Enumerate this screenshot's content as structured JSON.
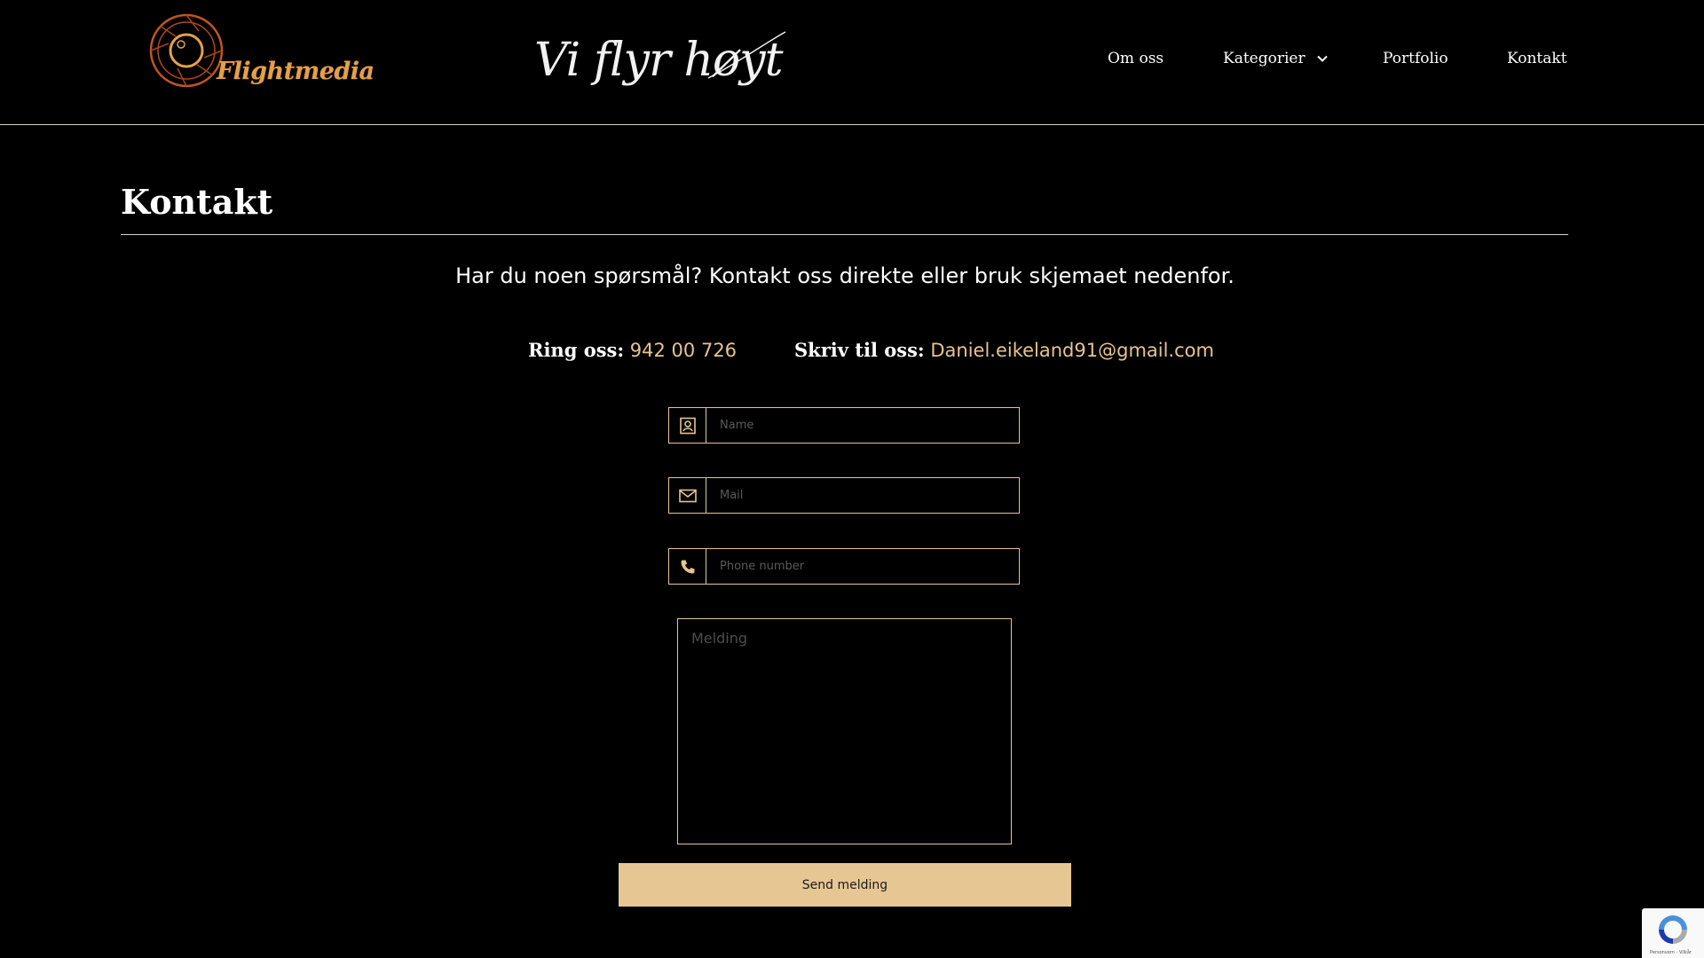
{
  "header": {
    "logo_text": "Flightmedia",
    "tagline": "Vi flyr høyt",
    "nav": [
      {
        "label": "Om oss"
      },
      {
        "label": "Kategorier"
      },
      {
        "label": "Portfolio"
      },
      {
        "label": "Kontakt"
      }
    ]
  },
  "main": {
    "title": "Kontakt",
    "intro": "Har du noen spørsmål? Kontakt oss direkte eller bruk skjemaet nedenfor.",
    "phone": {
      "label": "Ring oss:",
      "value": "942 00 726"
    },
    "email": {
      "label": "Skriv til oss:",
      "value": "Daniel.eikeland91@gmail.com"
    }
  },
  "form": {
    "name_placeholder": "Name",
    "mail_placeholder": "Mail",
    "phone_placeholder": "Phone number",
    "message_placeholder": "Melding",
    "submit_label": "Send melding"
  },
  "recaptcha": {
    "text": "Personvern - Vilkår"
  },
  "colors": {
    "background": "#000000",
    "accent": "#e6c794",
    "link": "#e8c48e",
    "logo": "#e2a04a"
  },
  "icons": {
    "name": "contact-card-icon",
    "mail": "envelope-icon",
    "phone": "phone-icon",
    "dropdown": "chevron-down-icon",
    "recaptcha": "recaptcha-icon"
  }
}
